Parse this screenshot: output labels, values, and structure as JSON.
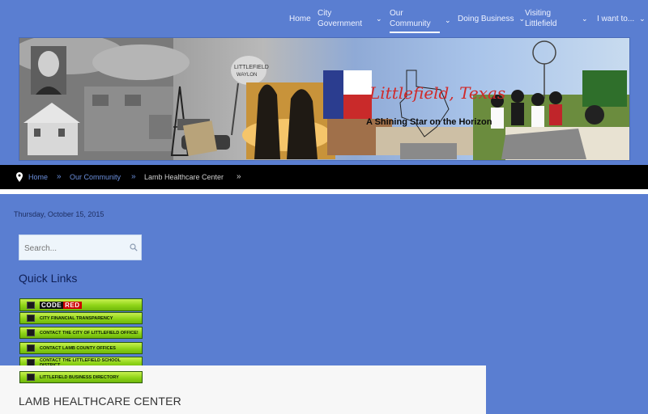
{
  "nav": {
    "items": [
      {
        "label": "Home"
      },
      {
        "label": "City\nGovernment"
      },
      {
        "label": "Our\nCommunity"
      },
      {
        "label": "Doing Business"
      },
      {
        "label": "Visiting\nLittlefield"
      },
      {
        "label": "I want to..."
      }
    ]
  },
  "banner": {
    "title": "Littlefield, Texas",
    "tagline": "A Shining Star on the Horizon",
    "tower_text": "LITTLEFIELD\nWAYLON\nJENNINGS"
  },
  "breadcrumb": {
    "home": "Home",
    "section": "Our Community",
    "current": "Lamb Healthcare Center"
  },
  "date": "Thursday, October 15, 2015",
  "search": {
    "placeholder": "Search..."
  },
  "quick_links": {
    "title": "Quick Links",
    "code_red_a": "CODE",
    "code_red_b": "RED",
    "items": [
      "CITY FINANCIAL TRANSPARENCY",
      "CONTACT THE CITY OF LITTLEFIELD OFFICE!",
      "CONTACT LAMB COUNTY OFFICES",
      "CONTACT THE LITTLEFIELD SCHOOL DISTRICT",
      "LITTLEFIELD BUSINESS DIRECTORY"
    ]
  },
  "page": {
    "heading": "LAMB HEALTHCARE CENTER"
  }
}
